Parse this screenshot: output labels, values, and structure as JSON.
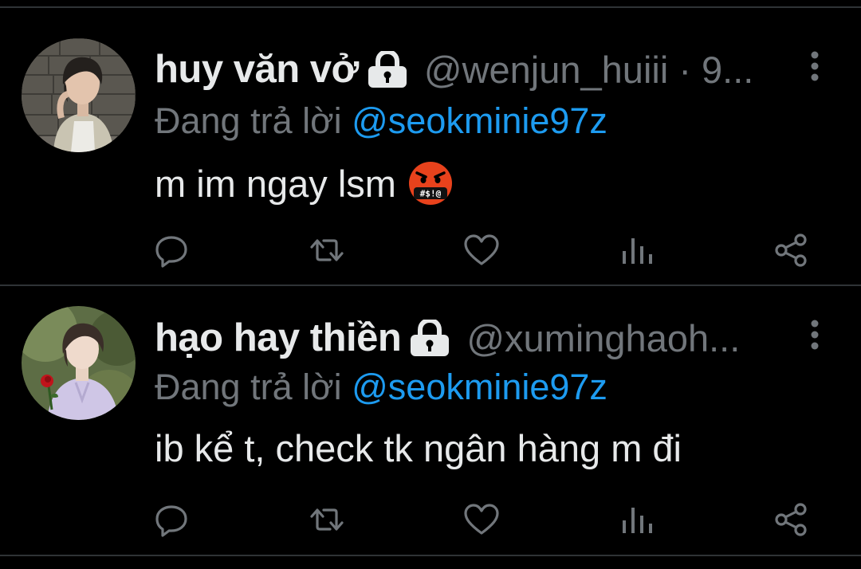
{
  "tweets": [
    {
      "display_name": "huy văn vở",
      "handle_time": "@wenjun_huiii · 9...",
      "reply_prefix": "Đang trả lời ",
      "reply_mention": "@seokminie97z",
      "text": "m im ngay lsm",
      "emoji": "face-with-symbols-on-mouth",
      "locked": true
    },
    {
      "display_name": "hạo hay thiền",
      "handle_time": "@xuminghaoh...",
      "reply_prefix": "Đang trả lời ",
      "reply_mention": "@seokminie97z",
      "text": "ib kể t, check tk ngân hàng m đi",
      "locked": true
    }
  ],
  "icons": {
    "lock": "lock-icon",
    "more": "more-vertical-icon",
    "reply": "reply-icon",
    "retweet": "retweet-icon",
    "like": "heart-icon",
    "views": "views-icon",
    "share": "share-icon"
  },
  "colors": {
    "background": "#000000",
    "text": "#e7e9ea",
    "secondary": "#71767b",
    "mention": "#1d9bf0",
    "divider": "#2f3336",
    "emoji": "#e8421c"
  }
}
